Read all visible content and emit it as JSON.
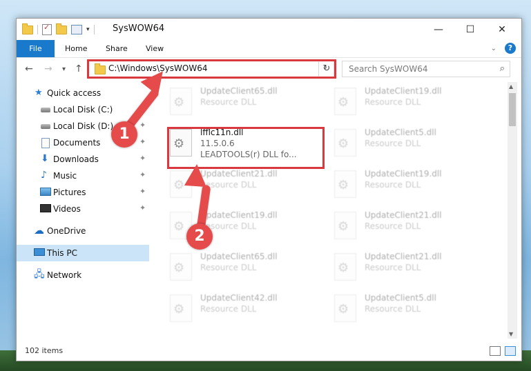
{
  "window": {
    "title": "SysWOW64",
    "minimize": "—",
    "maximize": "☐",
    "close": "✕"
  },
  "ribbon": {
    "tabs": [
      "File",
      "Home",
      "Share",
      "View"
    ],
    "help_label": "?"
  },
  "nav": {
    "back": "←",
    "forward": "→",
    "recent": "▾",
    "up": "↑",
    "address": "C:\\Windows\\SysWOW64",
    "refresh": "↻",
    "search_placeholder": "Search SysWOW64",
    "search_icon": "⌕"
  },
  "sidebar": {
    "items": [
      {
        "label": "Quick access",
        "icon": "star-icon"
      },
      {
        "label": "Local Disk (C:)",
        "icon": "drive-icon",
        "pinned": true
      },
      {
        "label": "Local Disk (D:)",
        "icon": "drive-icon",
        "pinned": true
      },
      {
        "label": "Documents",
        "icon": "documents-icon",
        "pinned": true
      },
      {
        "label": "Downloads",
        "icon": "downloads-icon",
        "pinned": true
      },
      {
        "label": "Music",
        "icon": "music-icon",
        "pinned": true
      },
      {
        "label": "Pictures",
        "icon": "pictures-icon",
        "pinned": true
      },
      {
        "label": "Videos",
        "icon": "videos-icon",
        "pinned": true
      },
      {
        "label": "OneDrive",
        "icon": "onedrive-icon"
      },
      {
        "label": "This PC",
        "icon": "this-pc-icon",
        "selected": true
      },
      {
        "label": "Network",
        "icon": "network-icon"
      }
    ],
    "pin_glyph": "📌"
  },
  "files": {
    "highlighted": {
      "name": "lfflc11n.dll",
      "version": "11.5.0.6",
      "description": "LEADTOOLS(r) DLL fo..."
    },
    "background": [
      {
        "name": "UpdateClient65.dll",
        "type": "Resource DLL"
      },
      {
        "name": "UpdateClient19.dll",
        "type": "Resource DLL"
      },
      {
        "name": "UpdateClient5.dll",
        "type": "Resource DLL"
      },
      {
        "name": "UpdateClient21.dll",
        "type": "Resource DLL"
      },
      {
        "name": "UpdateClient19.dll",
        "type": "Resource DLL"
      },
      {
        "name": "UpdateClient19.dll",
        "type": "Resource DLL"
      },
      {
        "name": "UpdateClient21.dll",
        "type": "Resource DLL"
      },
      {
        "name": "UpdateClient65.dll",
        "type": "Resource DLL"
      },
      {
        "name": "UpdateClient21.dll",
        "type": "Resource DLL"
      },
      {
        "name": "UpdateClient42.dll",
        "type": "Resource DLL"
      },
      {
        "name": "UpdateClient5.dll",
        "type": "Resource DLL"
      }
    ]
  },
  "status": {
    "items_count": "102 items"
  },
  "callouts": [
    "1",
    "2"
  ],
  "colors": {
    "accent": "#1979ca",
    "highlight_red": "#d9393e",
    "callout_red": "#e64b4b",
    "selected_bg": "#cce4f7"
  }
}
